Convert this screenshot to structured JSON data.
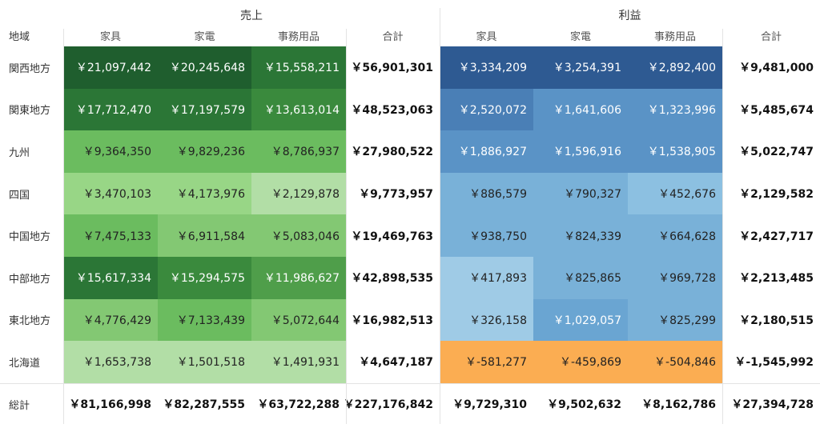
{
  "header": {
    "region_label": "地域",
    "groups": [
      {
        "label": "売上"
      },
      {
        "label": "利益"
      }
    ],
    "columns": [
      "家具",
      "家電",
      "事務用品",
      "合計",
      "家具",
      "家電",
      "事務用品",
      "合計"
    ]
  },
  "colors": {
    "green_scale": [
      "#b2dea6",
      "#98d686",
      "#83c873",
      "#6bbc5f",
      "#4f9e4a",
      "#3a8a3d",
      "#2b7636",
      "#1f5e2e"
    ],
    "blue_scale": [
      "#9fcbe6",
      "#8cc0e1",
      "#79b1d8",
      "#6aa5d2",
      "#5a93c6",
      "#4a7fb6",
      "#3d6ea8",
      "#2e5a92"
    ],
    "negative": "#fbad52",
    "light_text": "#ffffff",
    "dark_text": "#222222"
  },
  "rows": [
    {
      "label": "関西地方",
      "cells": [
        "￥21,097,442",
        "￥20,245,648",
        "￥15,558,211",
        "￥56,901,301",
        "￥3,334,209",
        "￥3,254,391",
        "￥2,892,400",
        "￥9,481,000"
      ],
      "shade": [
        7,
        7,
        6,
        -1,
        7,
        7,
        7,
        -1
      ]
    },
    {
      "label": "関東地方",
      "cells": [
        "￥17,712,470",
        "￥17,197,579",
        "￥13,613,014",
        "￥48,523,063",
        "￥2,520,072",
        "￥1,641,606",
        "￥1,323,996",
        "￥5,485,674"
      ],
      "shade": [
        6,
        6,
        5,
        -1,
        5,
        4,
        4,
        -1
      ]
    },
    {
      "label": "九州",
      "cells": [
        "￥9,364,350",
        "￥9,829,236",
        "￥8,786,937",
        "￥27,980,522",
        "￥1,886,927",
        "￥1,596,916",
        "￥1,538,905",
        "￥5,022,747"
      ],
      "shade": [
        3,
        3,
        3,
        -1,
        4,
        4,
        4,
        -1
      ]
    },
    {
      "label": "四国",
      "cells": [
        "￥3,470,103",
        "￥4,173,976",
        "￥2,129,878",
        "￥9,773,957",
        "￥886,579",
        "￥790,327",
        "￥452,676",
        "￥2,129,582"
      ],
      "shade": [
        1,
        1,
        0,
        -1,
        2,
        2,
        1,
        -1
      ]
    },
    {
      "label": "中国地方",
      "cells": [
        "￥7,475,133",
        "￥6,911,584",
        "￥5,083,046",
        "￥19,469,763",
        "￥938,750",
        "￥824,339",
        "￥664,628",
        "￥2,427,717"
      ],
      "shade": [
        3,
        2,
        2,
        -1,
        2,
        2,
        2,
        -1
      ]
    },
    {
      "label": "中部地方",
      "cells": [
        "￥15,617,334",
        "￥15,294,575",
        "￥11,986,627",
        "￥42,898,535",
        "￥417,893",
        "￥825,865",
        "￥969,728",
        "￥2,213,485"
      ],
      "shade": [
        6,
        5,
        4,
        -1,
        0,
        2,
        2,
        -1
      ]
    },
    {
      "label": "東北地方",
      "cells": [
        "￥4,776,429",
        "￥7,133,439",
        "￥5,072,644",
        "￥16,982,513",
        "￥326,158",
        "￥1,029,057",
        "￥825,299",
        "￥2,180,515"
      ],
      "shade": [
        2,
        3,
        2,
        -1,
        0,
        3,
        2,
        -1
      ]
    },
    {
      "label": "北海道",
      "cells": [
        "￥1,653,738",
        "￥1,501,518",
        "￥1,491,931",
        "￥4,647,187",
        "￥-581,277",
        "￥-459,869",
        "￥-504,846",
        "￥-1,545,992"
      ],
      "shade": [
        0,
        0,
        0,
        -1,
        -2,
        -2,
        -2,
        -1
      ]
    },
    {
      "label": "総計",
      "cells": [
        "￥81,166,998",
        "￥82,287,555",
        "￥63,722,288",
        "￥227,176,842",
        "￥9,729,310",
        "￥9,502,632",
        "￥8,162,786",
        "￥27,394,728"
      ],
      "shade": [
        -1,
        -1,
        -1,
        -1,
        -1,
        -1,
        -1,
        -1
      ]
    }
  ]
}
